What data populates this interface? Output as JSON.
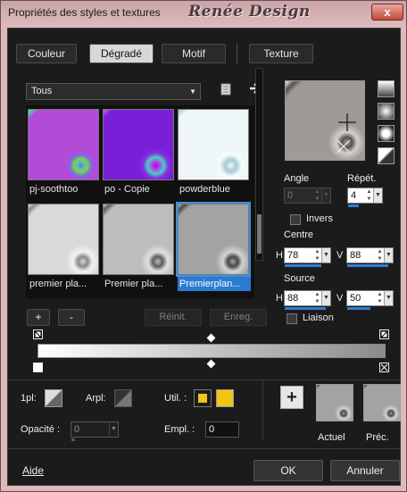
{
  "window": {
    "title": "Propriétés des styles et textures",
    "watermark": "Renée Design",
    "close_label": "x"
  },
  "tabs": [
    {
      "label": "Couleur",
      "active": false
    },
    {
      "label": "Dégradé",
      "active": true
    },
    {
      "label": "Motif",
      "active": false
    },
    {
      "label": "Texture",
      "active": false
    }
  ],
  "preset_dropdown": {
    "value": "Tous"
  },
  "thumbnails": [
    {
      "label": "pj-soothtoo",
      "selected": false
    },
    {
      "label": "po - Copie",
      "selected": false
    },
    {
      "label": "powderblue",
      "selected": false
    },
    {
      "label": "premier pla...",
      "selected": false
    },
    {
      "label": "Premier pla...",
      "selected": false
    },
    {
      "label": "Premierplan...",
      "selected": true
    }
  ],
  "list_buttons": {
    "add": "+",
    "remove": "-",
    "reset": "Réinit.",
    "save": "Enreg."
  },
  "angle": {
    "label": "Angle",
    "value": "0"
  },
  "repeat": {
    "label": "Répét.",
    "value": "4"
  },
  "invert": {
    "label": "Invers",
    "checked": false
  },
  "center": {
    "label": "Centre",
    "h_label": "H",
    "h_value": "78",
    "v_label": "V",
    "v_value": "88"
  },
  "source": {
    "label": "Source",
    "h_label": "H",
    "h_value": "88",
    "v_label": "V",
    "v_value": "50"
  },
  "link": {
    "label": "Liaison",
    "checked": false
  },
  "editor": {
    "first_plane_label": "1pl:",
    "background_plane_label": "Arpl:",
    "use_label": "Util. :",
    "opacity_label": "Opacité :",
    "opacity_value": "0",
    "location_label": "Empl. :",
    "location_value": "0",
    "use_color": "#f2c418"
  },
  "previews": {
    "current_label": "Actuel",
    "previous_label": "Préc.",
    "add_label": "+"
  },
  "footer": {
    "help": "Aide",
    "ok": "OK",
    "cancel": "Annuler"
  },
  "colors": {
    "accent": "#2a7bd0",
    "title_bar": "#d9b5b8",
    "panel_bg": "#1b1b1b"
  }
}
